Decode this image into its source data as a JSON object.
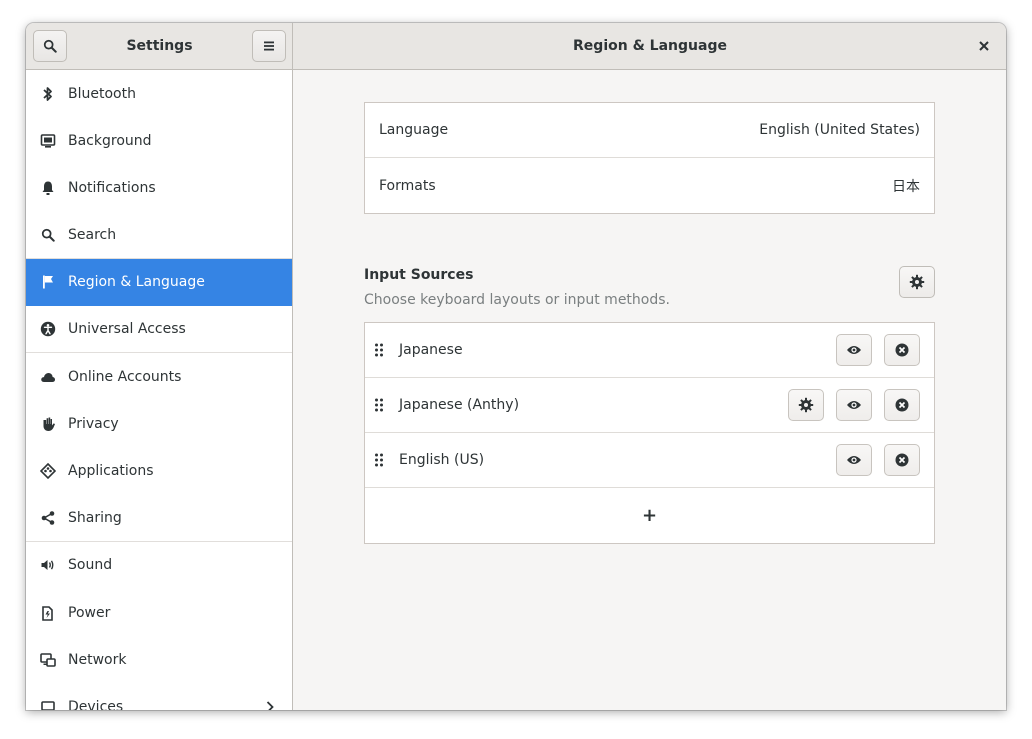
{
  "header": {
    "sidebar_title": "Settings",
    "panel_title": "Region & Language"
  },
  "sidebar": {
    "items": [
      {
        "label": "Bluetooth",
        "icon": "bluetooth-icon"
      },
      {
        "label": "Background",
        "icon": "background-icon"
      },
      {
        "label": "Notifications",
        "icon": "bell-icon"
      },
      {
        "label": "Search",
        "icon": "search-icon"
      },
      {
        "label": "Region & Language",
        "icon": "flag-icon",
        "active": true
      },
      {
        "label": "Universal Access",
        "icon": "accessibility-icon"
      },
      {
        "label": "Online Accounts",
        "icon": "cloud-icon"
      },
      {
        "label": "Privacy",
        "icon": "hand-icon"
      },
      {
        "label": "Applications",
        "icon": "applications-icon"
      },
      {
        "label": "Sharing",
        "icon": "share-icon"
      },
      {
        "label": "Sound",
        "icon": "speaker-icon"
      },
      {
        "label": "Power",
        "icon": "power-icon"
      },
      {
        "label": "Network",
        "icon": "network-icon"
      },
      {
        "label": "Devices",
        "icon": "devices-icon"
      }
    ]
  },
  "main": {
    "language_label": "Language",
    "language_value": "English (United States)",
    "formats_label": "Formats",
    "formats_value": "日本",
    "input_sources_title": "Input Sources",
    "input_sources_subtitle": "Choose keyboard layouts or input methods.",
    "sources": [
      {
        "name": "Japanese",
        "has_settings": false
      },
      {
        "name": "Japanese (Anthy)",
        "has_settings": true
      },
      {
        "name": "English (US)",
        "has_settings": false
      }
    ],
    "add_label": "+"
  },
  "colors": {
    "accent": "#3584e4",
    "sidebar_bg": "#ffffff",
    "content_bg": "#f6f5f4",
    "headerbar_bg": "#e8e6e3"
  }
}
